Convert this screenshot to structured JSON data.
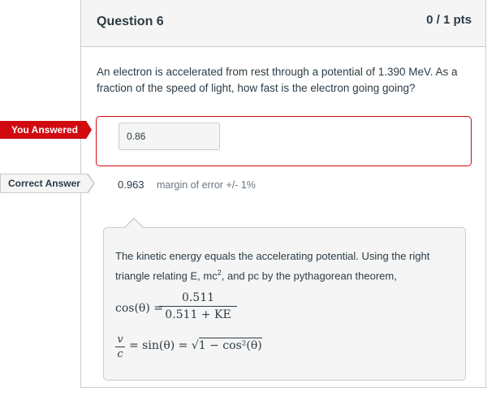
{
  "question": {
    "title": "Question 6",
    "points": "0 / 1 pts",
    "text": "An electron is accelerated from rest through a potential of 1.390 MeV. As a fraction of the speed of light, how fast is the electron going going?"
  },
  "you_answered": {
    "label": "You Answered",
    "value": "0.86"
  },
  "correct_answer": {
    "label": "Correct Answer",
    "value": "0.963",
    "margin": "margin of error +/- 1%"
  },
  "comment": {
    "text_part1": "The kinetic energy equals the accelerating potential.  Using the right triangle relating E, mc",
    "text_sup": "2",
    "text_part2": ", and pc by the pythagorean theorem,",
    "eq1_lhs": "cos(θ) =",
    "eq1_num": "0.511",
    "eq1_den": "0.511 + KE",
    "eq2_num": "v",
    "eq2_den": "c",
    "eq2_rest_a": "= sin(θ) = √",
    "eq2_rest_b": "1 − cos²(θ)"
  },
  "colors": {
    "incorrect": "#d10a10",
    "border": "#c7cdd1",
    "header_bg": "#f5f5f5",
    "text": "#2d3b45",
    "muted": "#6b7780"
  }
}
